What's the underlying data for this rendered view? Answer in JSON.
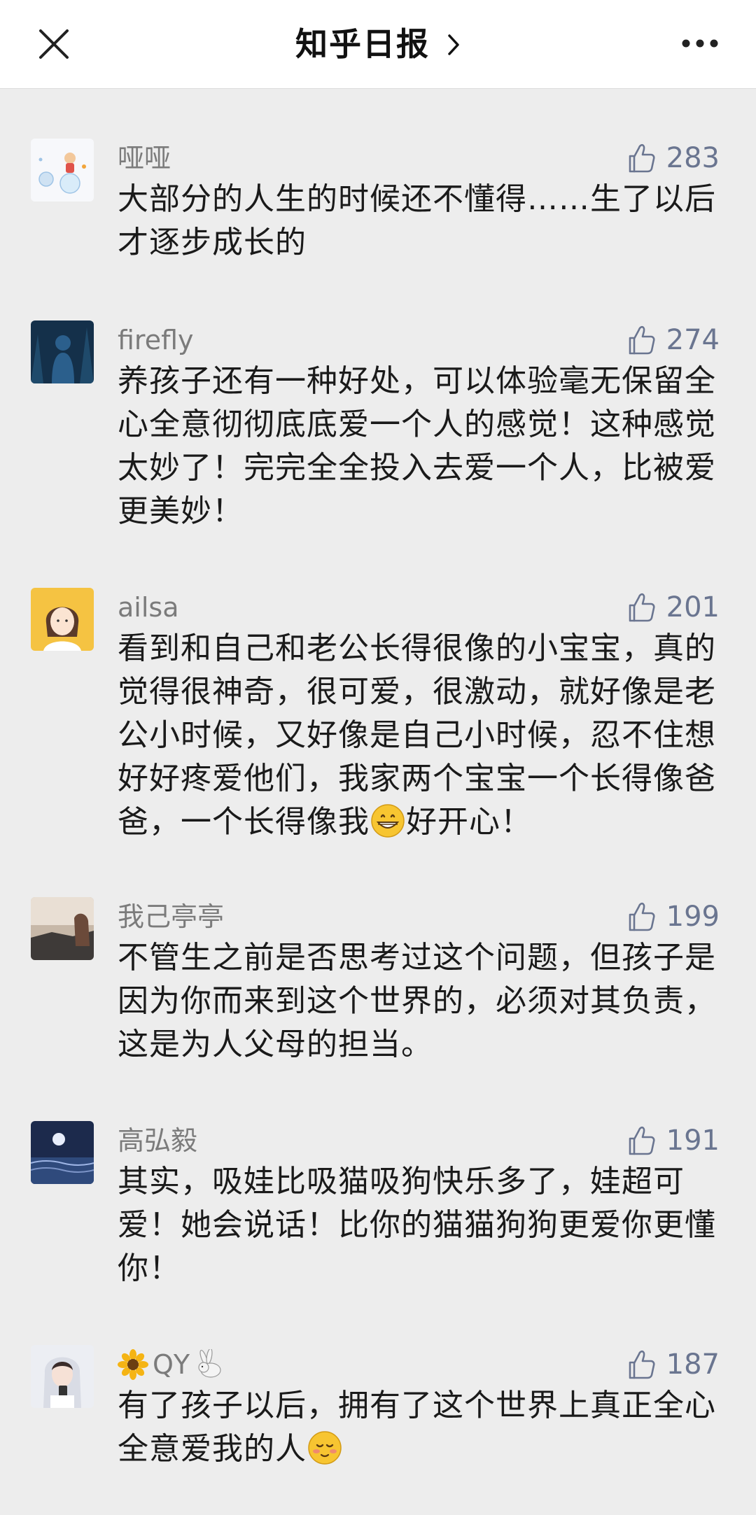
{
  "header": {
    "title": "知乎日报",
    "close_icon": "close-icon",
    "more_icon": "more-dots-icon",
    "chevron_icon": "chevron-right-icon"
  },
  "colors": {
    "background": "#ededed",
    "navbar": "#ffffff",
    "username": "#7b7b7b",
    "like": "#6a7590"
  },
  "comments": [
    {
      "username": "哑哑",
      "likes": "283",
      "text": "大部分的人生的时候还不懂得……生了以后才逐步成长的"
    },
    {
      "username": "firefly",
      "likes": "274",
      "text": "养孩子还有一种好处，可以体验毫无保留全心全意彻彻底底爱一个人的感觉！这种感觉太妙了！完完全全投入去爱一个人，比被爱更美妙！"
    },
    {
      "username": "ailsa",
      "likes": "201",
      "text_before": "看到和自己和老公长得很像的小宝宝，真的觉得很神奇，很可爱，很激动，就好像是老公小时候，又好像是自己小时候，忍不住想好好疼爱他们，我家两个宝宝一个长得像爸爸，一个长得像我",
      "emoji": "grinning-face-emoji",
      "text_after": "好开心！"
    },
    {
      "username": "我己亭亭",
      "likes": "199",
      "text": "不管生之前是否思考过这个问题，但孩子是因为你而来到这个世界的，必须对其负责，这是为人父母的担当。"
    },
    {
      "username": "高弘毅",
      "likes": "191",
      "text": "其实，吸娃比吸猫吸狗快乐多了，娃超可爱！她会说话！比你的猫猫狗狗更爱你更懂你！"
    },
    {
      "username": "QY",
      "username_prefix_icon": "sunflower-emoji",
      "username_suffix_icon": "rabbit-emoji",
      "likes": "187",
      "text_before": "有了孩子以后，拥有了这个世界上真正全心全意爱我的人",
      "emoji": "blushing-face-emoji"
    }
  ]
}
